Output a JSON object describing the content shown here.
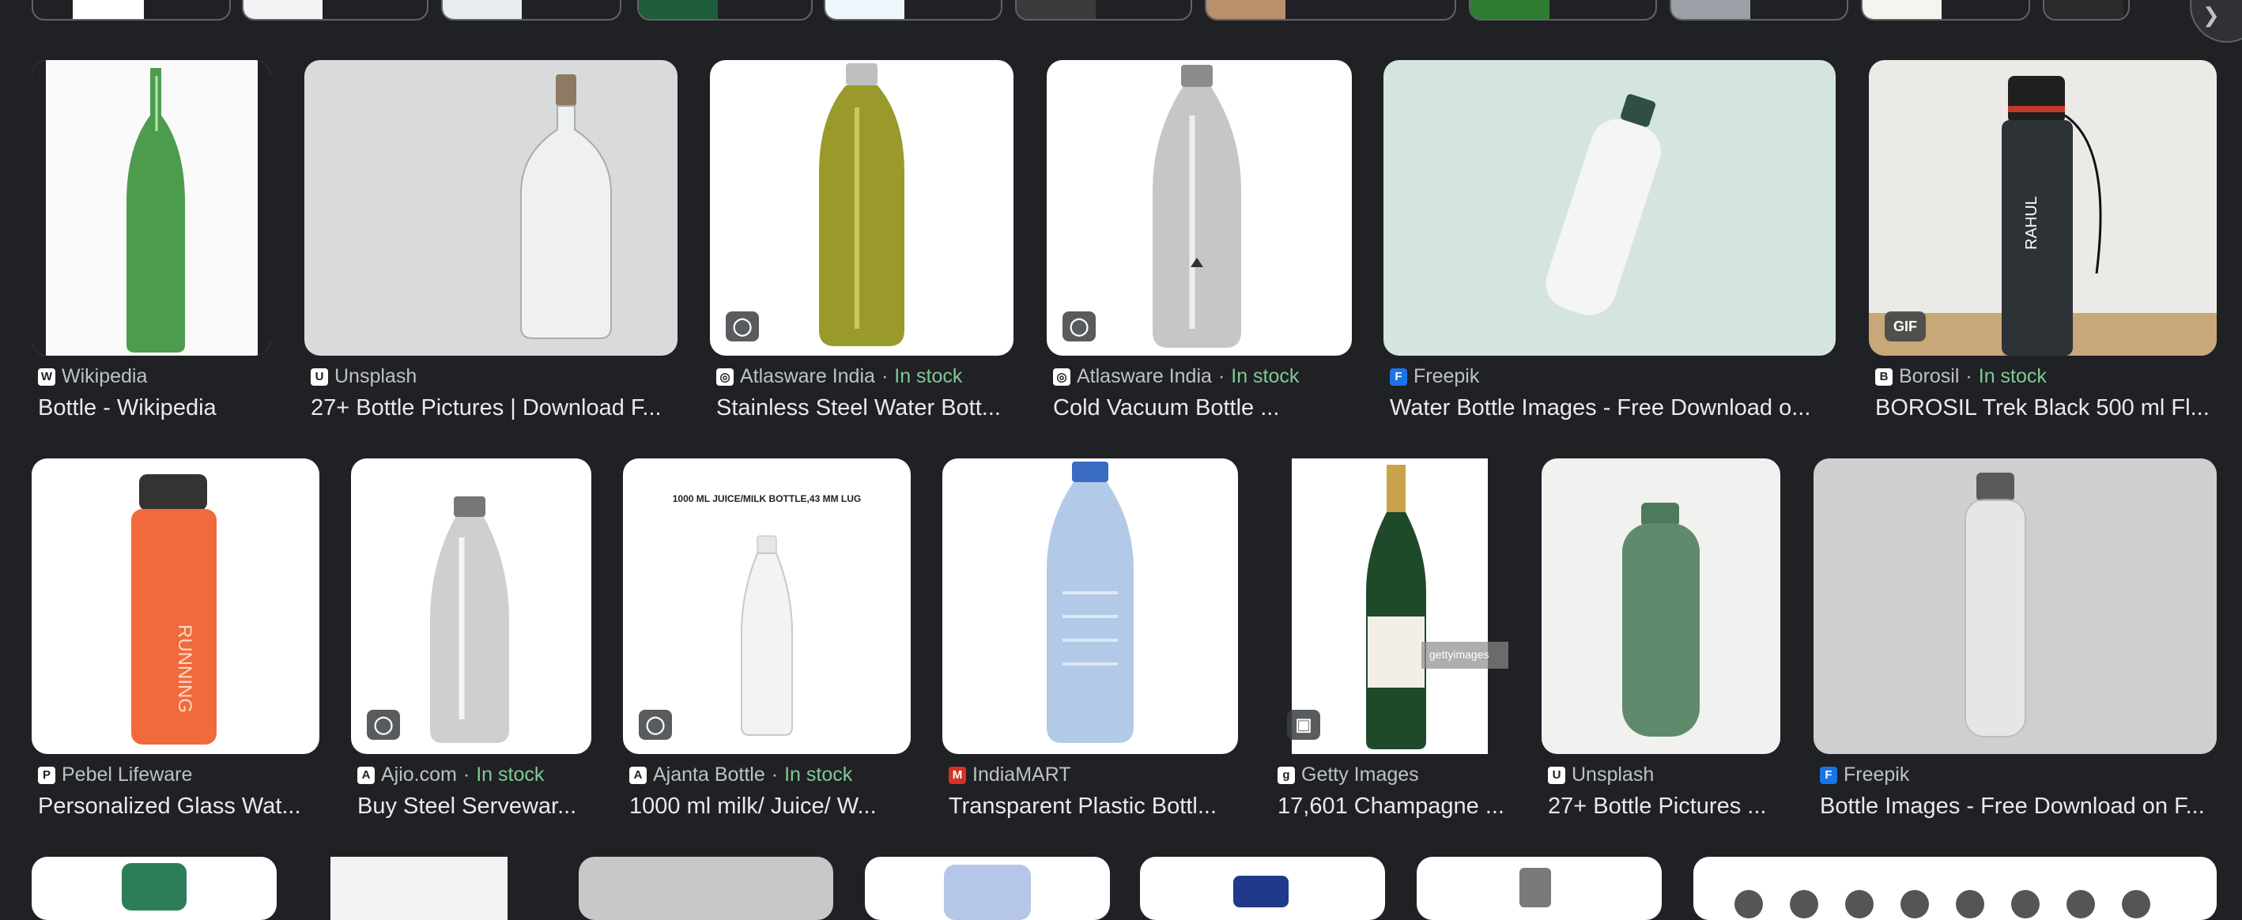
{
  "row1": [
    {
      "source": "Wikipedia",
      "favicon": "W",
      "in_stock": "",
      "title": "Bottle - Wikipedia"
    },
    {
      "source": "Unsplash",
      "favicon": "U",
      "in_stock": "",
      "title": "27+ Bottle Pictures | Download F..."
    },
    {
      "source": "Atlasware India",
      "favicon": "◎",
      "in_stock": "In stock",
      "title": "Stainless Steel Water Bott...",
      "badge": "tag-icon"
    },
    {
      "source": "Atlasware India",
      "favicon": "◎",
      "in_stock": "In stock",
      "title": "Cold Vacuum Bottle ...",
      "badge": "tag-icon"
    },
    {
      "source": "Freepik",
      "favicon": "F",
      "in_stock": "",
      "title": "Water Bottle Images - Free Download o..."
    },
    {
      "source": "Borosil",
      "favicon": "B",
      "in_stock": "In stock",
      "title": "BOROSIL Trek Black 500 ml Fl...",
      "badge_text": "GIF",
      "bottle_text": "RAHUL"
    }
  ],
  "row2": [
    {
      "source": "Pebel Lifeware",
      "favicon": "P",
      "in_stock": "",
      "title": "Personalized Glass Wat...",
      "bottle_text": "RUNNING"
    },
    {
      "source": "Ajio.com",
      "favicon": "A",
      "in_stock": "In stock",
      "title": "Buy Steel Servewar...",
      "badge": "tag-icon"
    },
    {
      "source": "Ajanta Bottle",
      "favicon": "A",
      "in_stock": "In stock",
      "title": "1000 ml milk/ Juice/ W...",
      "badge": "tag-icon",
      "image_caption": "1000 ML JUICE/MILK BOTTLE,43 MM LUG"
    },
    {
      "source": "IndiaMART",
      "favicon": "M",
      "in_stock": "",
      "title": "Transparent Plastic Bottl..."
    },
    {
      "source": "Getty Images",
      "favicon": "g",
      "in_stock": "",
      "title": "17,601 Champagne ...",
      "badge": "image-icon",
      "watermark": "gettyimages"
    },
    {
      "source": "Unsplash",
      "favicon": "U",
      "in_stock": "",
      "title": "27+ Bottle Pictures ..."
    },
    {
      "source": "Freepik",
      "favicon": "F",
      "in_stock": "",
      "title": "Bottle Images - Free Download on F..."
    }
  ],
  "stock_separator": " · ",
  "colors": {
    "background": "#202124",
    "stock_green": "#81c995",
    "text": "#e8eaed",
    "muted": "#bdc1c6"
  }
}
